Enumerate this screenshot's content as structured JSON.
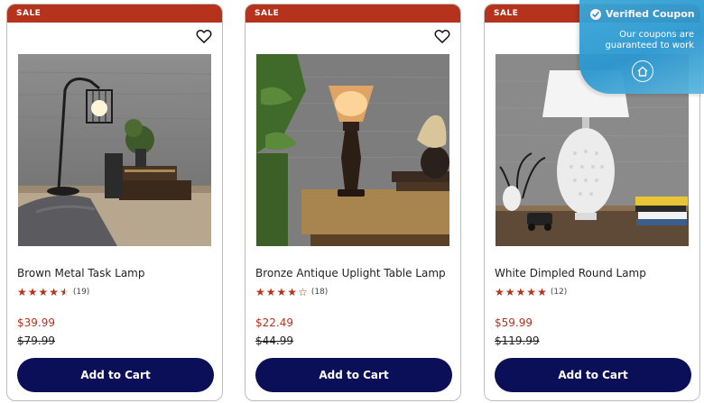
{
  "products": [
    {
      "badge": "SALE",
      "name": "Brown Metal Task Lamp",
      "rating_value": 4.5,
      "stars": [
        "full",
        "full",
        "full",
        "full",
        "half"
      ],
      "review_count": "(19)",
      "sale_price": "$39.99",
      "original_price": "$79.99",
      "cta": "Add to Cart"
    },
    {
      "badge": "SALE",
      "name": "Bronze Antique Uplight Table Lamp",
      "rating_value": 4,
      "stars": [
        "full",
        "full",
        "full",
        "full",
        "empty"
      ],
      "review_count": "(18)",
      "sale_price": "$22.49",
      "original_price": "$44.99",
      "cta": "Add to Cart"
    },
    {
      "badge": "SALE",
      "name": "White Dimpled Round Lamp",
      "rating_value": 5,
      "stars": [
        "full",
        "full",
        "full",
        "full",
        "full"
      ],
      "review_count": "(12)",
      "sale_price": "$59.99",
      "original_price": "$119.99",
      "cta": "Add to Cart"
    }
  ],
  "coupon_popup": {
    "title": "Verified Coupon",
    "message_line1": "Our coupons are",
    "message_line2": "guaranteed to work",
    "icon": "home-icon"
  },
  "colors": {
    "sale_red": "#b5321c",
    "button_navy": "#0b0f57",
    "coupon_blue": "#2b97cf"
  },
  "icons": {
    "wishlist": "heart-outline-icon",
    "star": "star-icon",
    "verified": "check-circle-icon"
  }
}
